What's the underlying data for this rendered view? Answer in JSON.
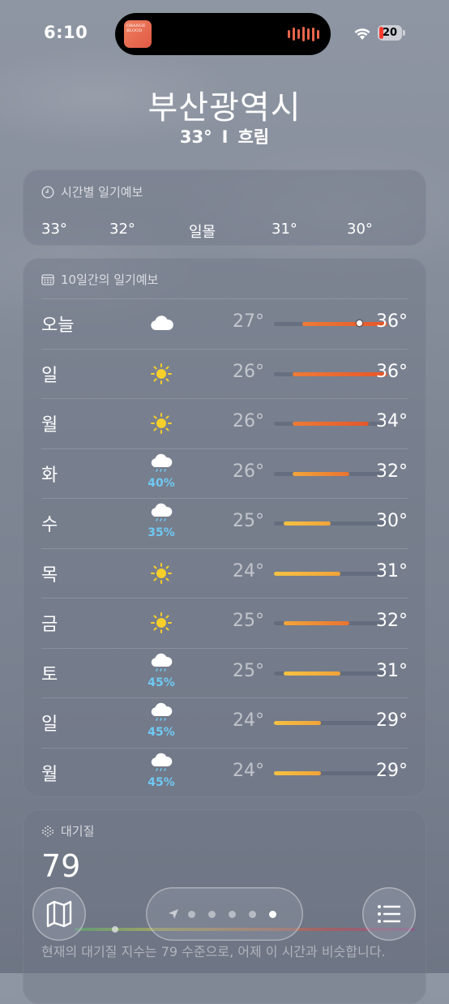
{
  "status_bar": {
    "time": "6:10",
    "battery": "20",
    "album_art_text": "ORANGE BLOOD"
  },
  "location": {
    "city": "부산광역시",
    "temperature": "33°",
    "separator": "I",
    "condition": "흐림"
  },
  "hourly": {
    "title": "시간별 일기예보",
    "items": [
      "33°",
      "32°",
      "일몰",
      "31°",
      "30°"
    ]
  },
  "daily": {
    "title": "10일간의 일기예보",
    "scale_min": 24,
    "scale_max": 36,
    "current_temp": 33,
    "days": [
      {
        "day": "오늘",
        "icon": "cloud-icon",
        "precip": "",
        "low": "27°",
        "high": "36°",
        "low_value": 27,
        "high_value": 36
      },
      {
        "day": "일",
        "icon": "sun-icon",
        "precip": "",
        "low": "26°",
        "high": "36°",
        "low_value": 26,
        "high_value": 36
      },
      {
        "day": "월",
        "icon": "sun-icon",
        "precip": "",
        "low": "26°",
        "high": "34°",
        "low_value": 26,
        "high_value": 34
      },
      {
        "day": "화",
        "icon": "rain-cloud-icon",
        "precip": "40%",
        "low": "26°",
        "high": "32°",
        "low_value": 26,
        "high_value": 32
      },
      {
        "day": "수",
        "icon": "rain-cloud-icon",
        "precip": "35%",
        "low": "25°",
        "high": "30°",
        "low_value": 25,
        "high_value": 30
      },
      {
        "day": "목",
        "icon": "sun-icon",
        "precip": "",
        "low": "24°",
        "high": "31°",
        "low_value": 24,
        "high_value": 31
      },
      {
        "day": "금",
        "icon": "sun-icon",
        "precip": "",
        "low": "25°",
        "high": "32°",
        "low_value": 25,
        "high_value": 32
      },
      {
        "day": "토",
        "icon": "rain-cloud-icon",
        "precip": "45%",
        "low": "25°",
        "high": "31°",
        "low_value": 25,
        "high_value": 31
      },
      {
        "day": "일",
        "icon": "rain-cloud-icon",
        "precip": "45%",
        "low": "24°",
        "high": "29°",
        "low_value": 24,
        "high_value": 29
      },
      {
        "day": "월",
        "icon": "rain-cloud-icon",
        "precip": "45%",
        "low": "24°",
        "high": "29°",
        "low_value": 24,
        "high_value": 29
      }
    ]
  },
  "air_quality": {
    "title": "대기질",
    "value": "79",
    "description": "현재의 대기질 지수는 79 수준으로, 어제 이 시간과 비슷합니다."
  },
  "pager": {
    "page_count": 5,
    "active_page": 5
  },
  "colors": {
    "precip": "#6fc9f2",
    "sun": "#f7cf2a",
    "warm": "#e8672d",
    "mild": "#f0a63a"
  }
}
